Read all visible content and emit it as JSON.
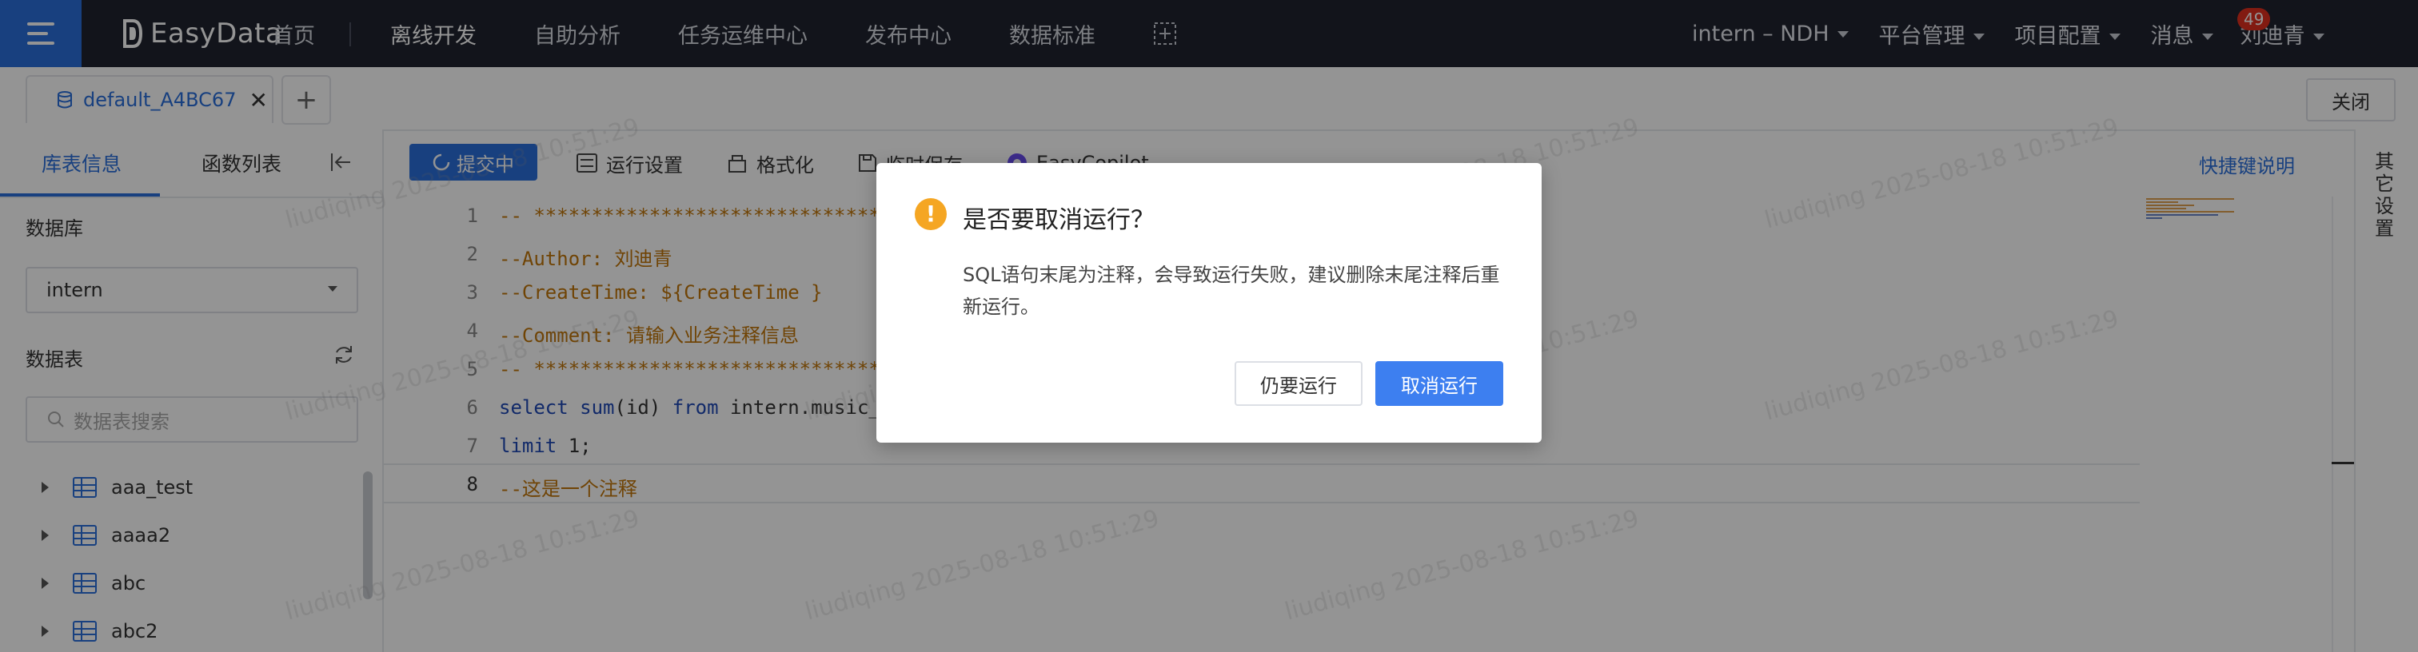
{
  "app": {
    "name": "EasyData"
  },
  "nav": {
    "items": [
      "首页",
      "离线开发",
      "自助分析",
      "任务运维中心",
      "发布中心",
      "数据标准"
    ],
    "active": "离线开发"
  },
  "right_nav": {
    "project": "intern – NDH",
    "platform": "平台管理",
    "project_config": "项目配置",
    "messages": "消息",
    "message_count": "49",
    "user": "刘迪青"
  },
  "tabs": {
    "file_tab": "default_A4BC67",
    "close_label": "关闭"
  },
  "sidebar": {
    "tab_db_info": "库表信息",
    "tab_functions": "函数列表",
    "database_label": "数据库",
    "database_value": "intern",
    "tables_label": "数据表",
    "search_placeholder": "数据表搜索",
    "tables": [
      "aaa_test",
      "aaaa2",
      "abc",
      "abc2"
    ]
  },
  "toolbar": {
    "submitting": "提交中",
    "run_settings": "运行设置",
    "format": "格式化",
    "temp_save": "临时保存",
    "copilot": "EasyCopilot",
    "shortcuts": "快捷键说明"
  },
  "editor": {
    "line_numbers": [
      "1",
      "2",
      "3",
      "4",
      "5",
      "6",
      "7",
      "8"
    ],
    "lines": {
      "l1": "-- ****************************************",
      "l2": "--Author: 刘迪青",
      "l3": "--CreateTime: ${CreateTime }",
      "l4": "--Comment: 请输入业务注释信息",
      "l5": "-- ****************************************",
      "l6_kw1": "select",
      "l6_fn": "sum",
      "l6_arg": "(id)",
      "l6_kw2": "from",
      "l6_rest": "intern.music_",
      "l7_kw": "limit",
      "l7_rest": " 1;",
      "l8": "--这是一个注释"
    }
  },
  "right_panel": {
    "label": "其它设置"
  },
  "watermark": {
    "text": "liudiqing 2025-08-18 10:51:29"
  },
  "dialog": {
    "title": "是否要取消运行？",
    "body": "SQL语句末尾为注释，会导致运行失败，建议删除末尾注释后重新运行。",
    "continue_button": "仍要运行",
    "cancel_button": "取消运行"
  },
  "colors": {
    "topbar": "#1f2430",
    "accent": "#2a6edb",
    "primary_button": "#3d7ff0",
    "warning": "#f5a623",
    "comment": "#c1760a"
  }
}
